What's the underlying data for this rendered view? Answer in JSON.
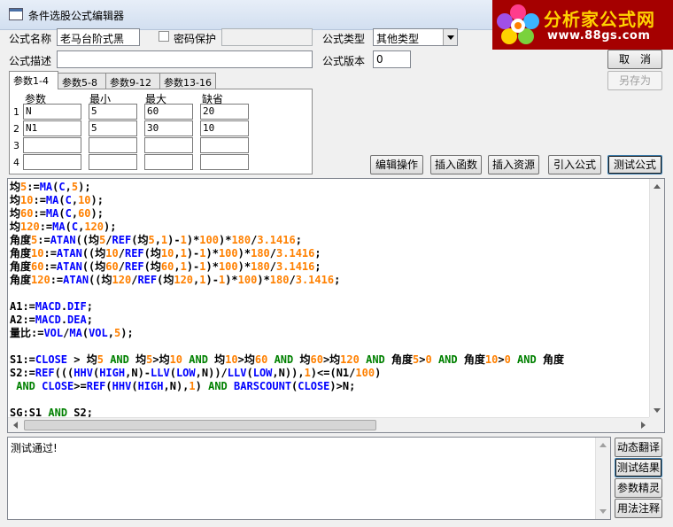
{
  "window": {
    "title": "条件选股公式编辑器"
  },
  "logo": {
    "name": "分析家公式网",
    "url": "www.88gs.com"
  },
  "form": {
    "name_label": "公式名称",
    "name_value": "老马台阶式黑",
    "password_label": "密码保护",
    "password_checked": false,
    "password_value": "",
    "type_label": "公式类型",
    "type_value": "其他类型",
    "desc_label": "公式描述",
    "desc_value": "",
    "version_label": "公式版本",
    "version_value": "0"
  },
  "buttons": {
    "cancel": "取　消",
    "save_as": "另存为",
    "edit_ops": "编辑操作",
    "insert_func": "插入函数",
    "insert_resource": "插入资源",
    "import_formula": "引入公式",
    "test_formula": "测试公式",
    "dynamic_translate": "动态翻译",
    "test_result": "测试结果",
    "param_wizard": "参数精灵",
    "usage_notes": "用法注释"
  },
  "tabs": [
    "参数1-4",
    "参数5-8",
    "参数9-12",
    "参数13-16"
  ],
  "params": {
    "headers": [
      "参数",
      "最小",
      "最大",
      "缺省"
    ],
    "rows": [
      {
        "num": "1",
        "name": "N",
        "min": "5",
        "max": "60",
        "default": "20"
      },
      {
        "num": "2",
        "name": "N1",
        "min": "5",
        "max": "30",
        "default": "10"
      },
      {
        "num": "3",
        "name": "",
        "min": "",
        "max": "",
        "default": ""
      },
      {
        "num": "4",
        "name": "",
        "min": "",
        "max": "",
        "default": ""
      }
    ]
  },
  "code_lines": [
    "均5:=MA(C,5);",
    "均10:=MA(C,10);",
    "均60:=MA(C,60);",
    "均120:=MA(C,120);",
    "角度5:=ATAN((均5/REF(均5,1)-1)*100)*180/3.1416;",
    "角度10:=ATAN((均10/REF(均10,1)-1)*100)*180/3.1416;",
    "角度60:=ATAN((均60/REF(均60,1)-1)*100)*180/3.1416;",
    "角度120:=ATAN((均120/REF(均120,1)-1)*100)*180/3.1416;",
    "",
    "A1:=MACD.DIF;",
    "A2:=MACD.DEA;",
    "量比:=VOL/MA(VOL,5);",
    "",
    "S1:=CLOSE > 均5 AND 均5>均10 AND 均10>均60 AND 均60>均120 AND 角度5>0 AND 角度10>0 AND 角度",
    "S2:=REF(((HHV(HIGH,N)-LLV(LOW,N))/LLV(LOW,N)),1)<=(N1/100)",
    " AND CLOSE>=REF(HHV(HIGH,N),1) AND BARSCOUNT(CLOSE)>N;",
    "",
    "SG:S1 AND S2;"
  ],
  "output": {
    "text": "测试通过!"
  },
  "colors": {
    "function": "#0000ff",
    "number": "#ff8000",
    "keyword": "#008000"
  }
}
